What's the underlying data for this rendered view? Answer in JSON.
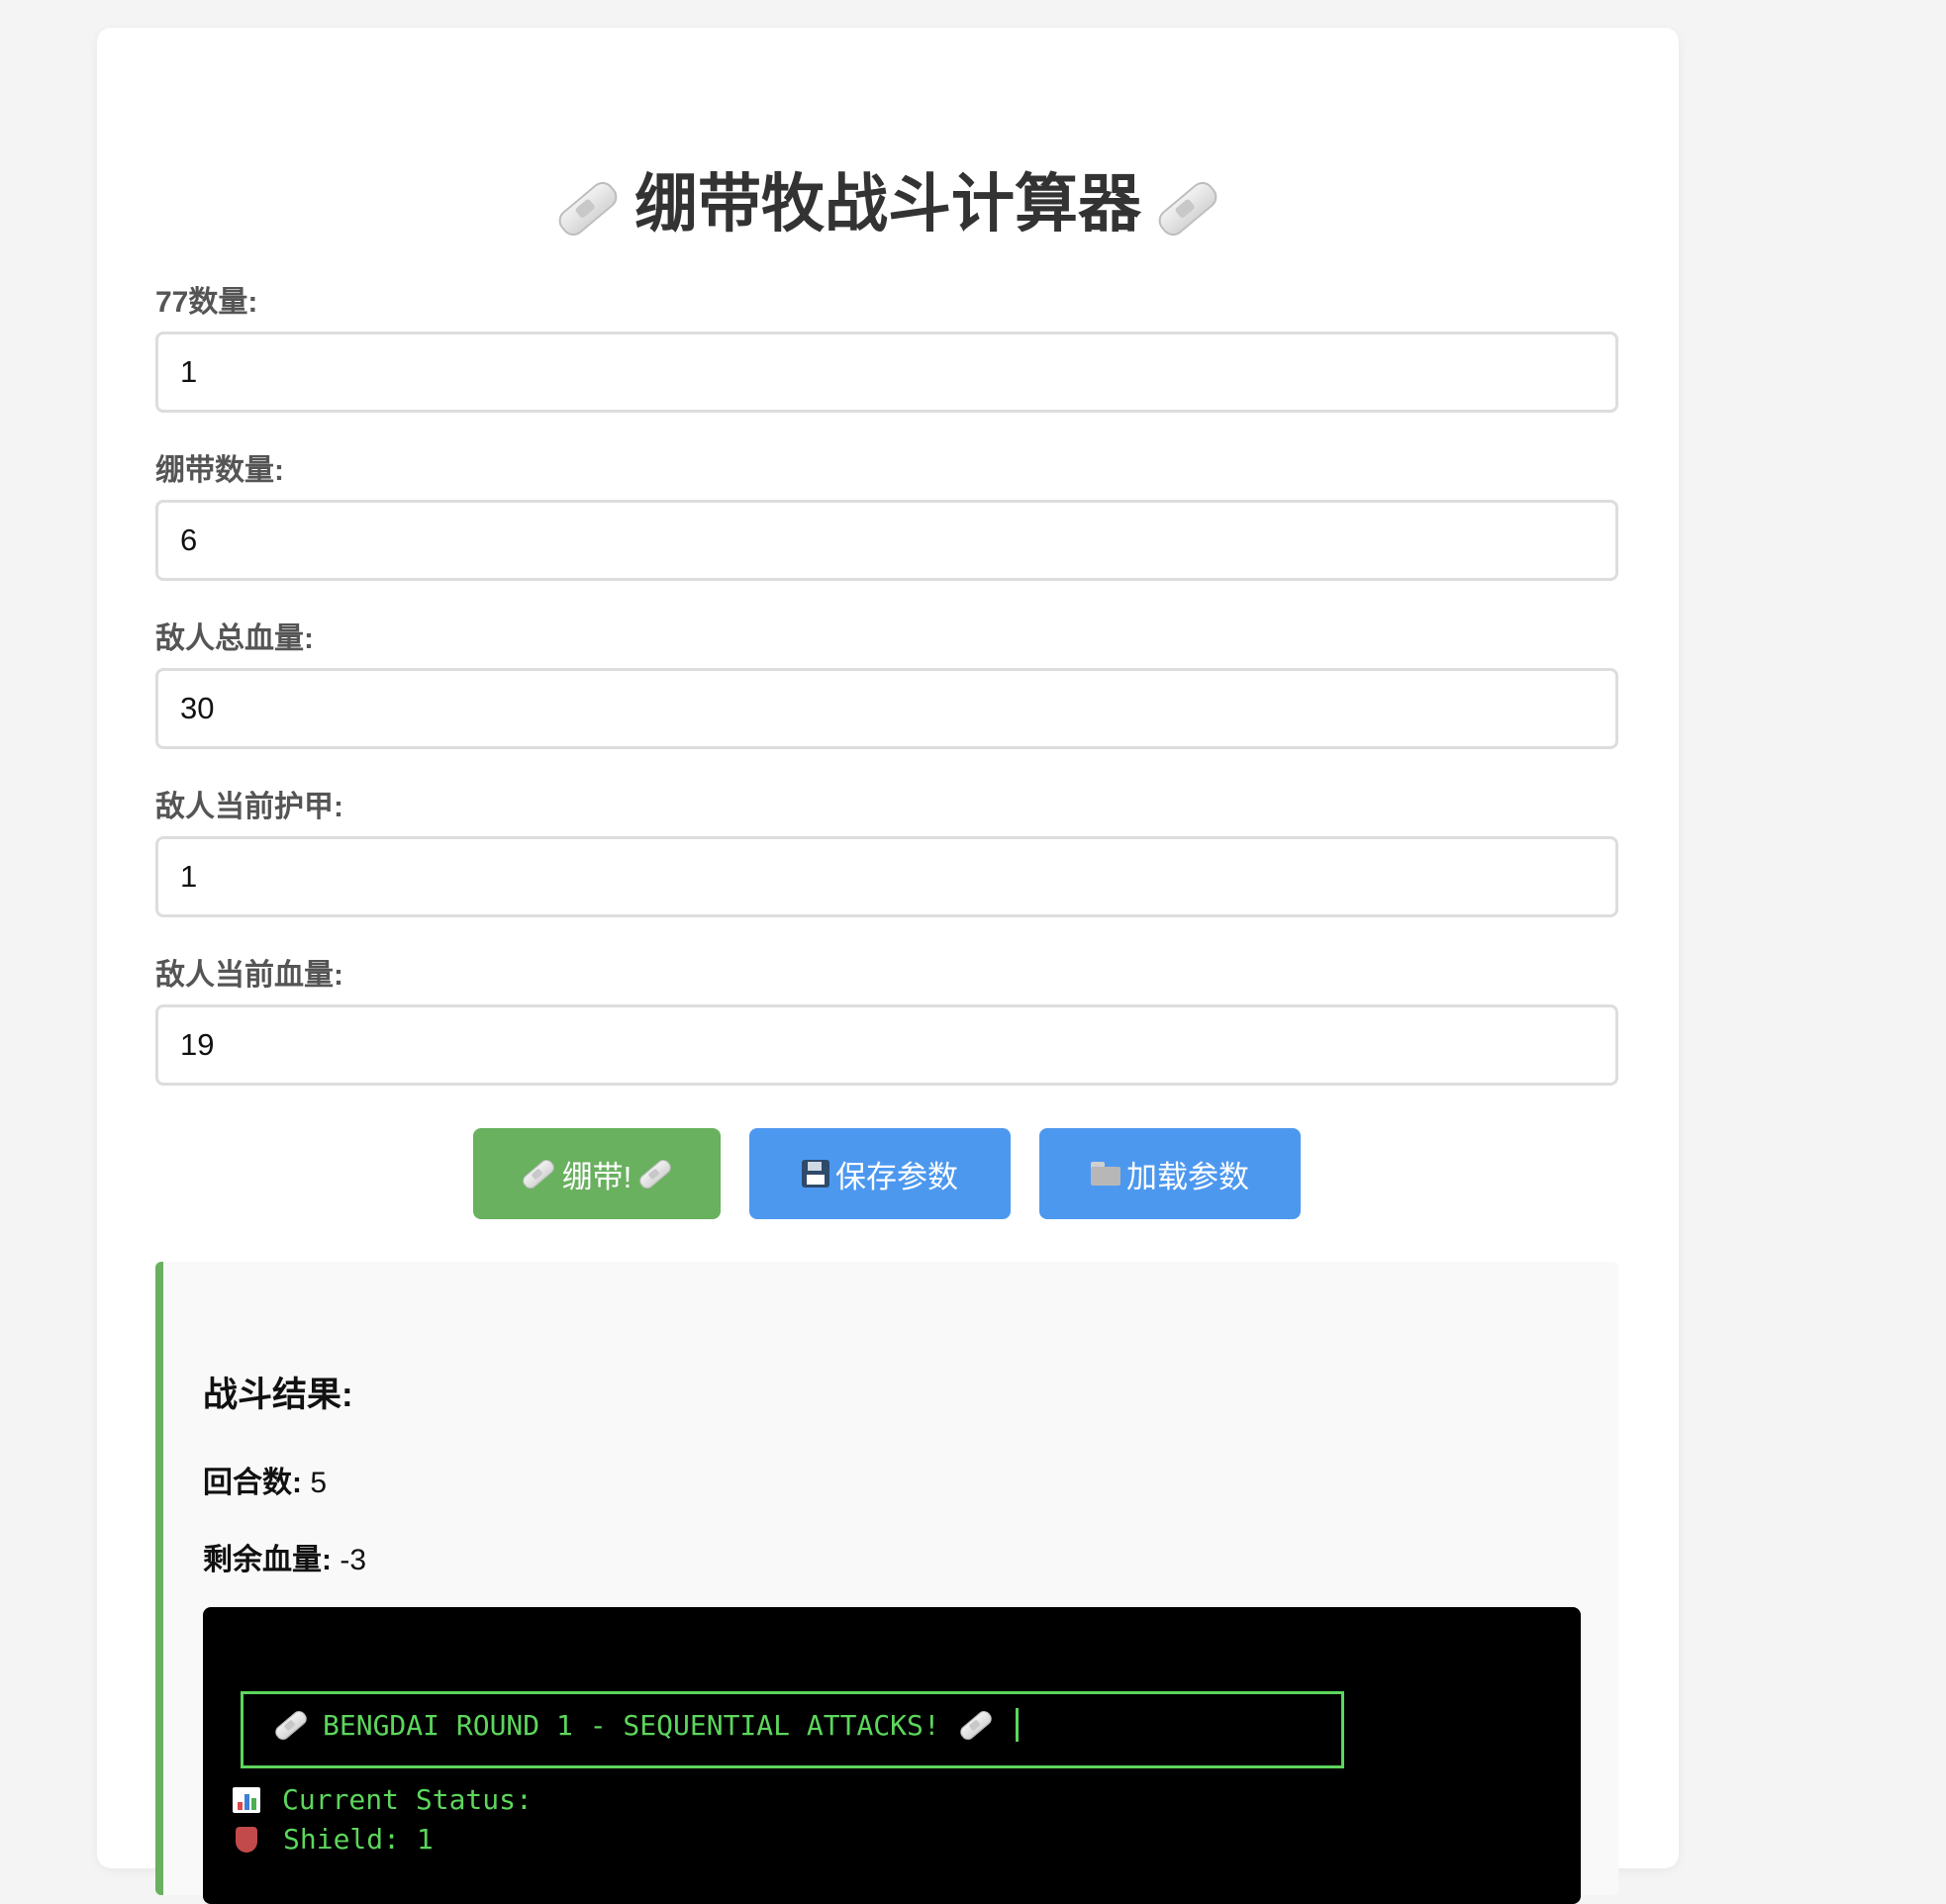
{
  "title": {
    "text": "绷带牧战斗计算器",
    "icon": "bandage-icon"
  },
  "fields": [
    {
      "label": "77数量:",
      "value": "1"
    },
    {
      "label": "绷带数量:",
      "value": "6"
    },
    {
      "label": "敌人总血量:",
      "value": "30"
    },
    {
      "label": "敌人当前护甲:",
      "value": "1"
    },
    {
      "label": "敌人当前血量:",
      "value": "19"
    }
  ],
  "buttons": {
    "bandage_label": "绷带!",
    "save_label": "保存参数",
    "load_label": "加载参数"
  },
  "result": {
    "title": "战斗结果:",
    "rounds_label": "回合数:",
    "rounds_value": "5",
    "remaining_label": "剩余血量:",
    "remaining_value": "-3"
  },
  "terminal": {
    "banner": "BENGDAI ROUND 1 - SEQUENTIAL ATTACKS!",
    "status_label": "Current Status:",
    "shield_line": "Shield: 1"
  },
  "colors": {
    "green": "#69b05f",
    "blue": "#4d98ef",
    "terminal_text": "#5cd65c"
  }
}
